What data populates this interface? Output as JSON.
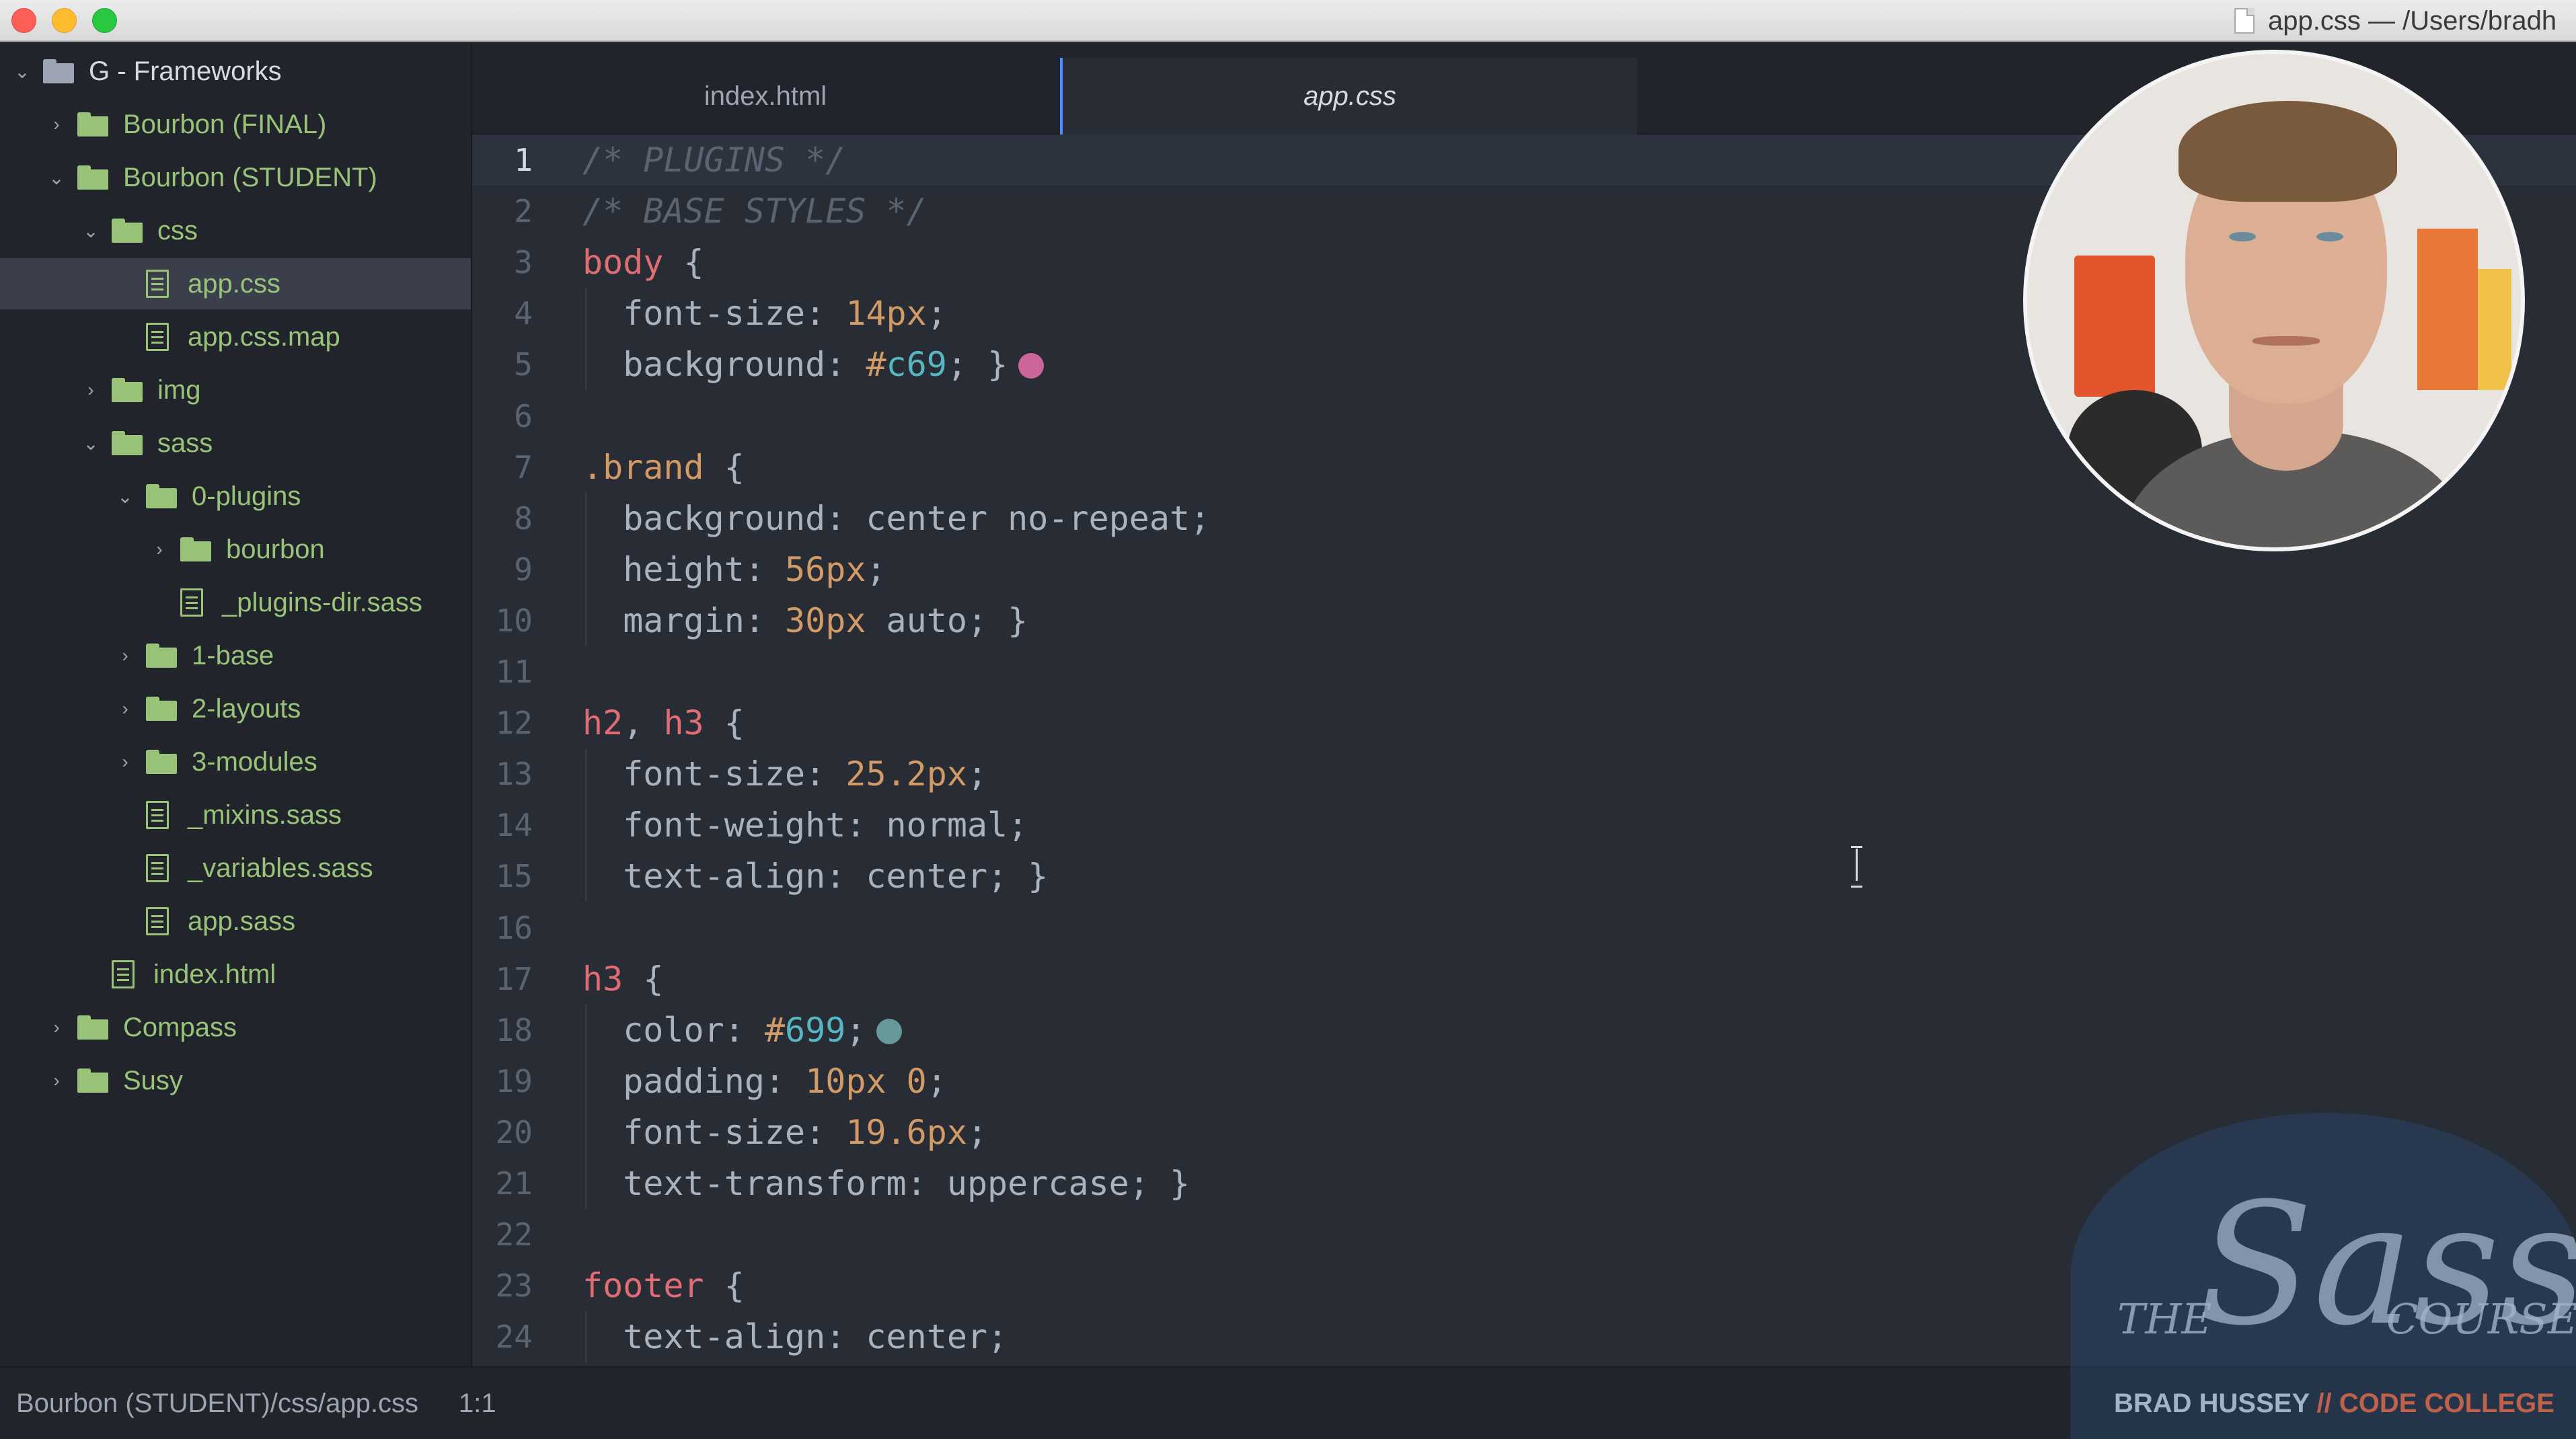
{
  "window": {
    "title": "app.css — /Users/bradh",
    "controls": [
      "close",
      "minimize",
      "zoom"
    ]
  },
  "sidebar": {
    "items": [
      {
        "label": "G - Frameworks",
        "type": "folder",
        "depth": 0,
        "expanded": true,
        "root": true
      },
      {
        "label": "Bourbon (FINAL)",
        "type": "folder",
        "depth": 1,
        "expanded": false
      },
      {
        "label": "Bourbon (STUDENT)",
        "type": "folder",
        "depth": 1,
        "expanded": true
      },
      {
        "label": "css",
        "type": "folder",
        "depth": 2,
        "expanded": true
      },
      {
        "label": "app.css",
        "type": "file",
        "depth": 3,
        "selected": true
      },
      {
        "label": "app.css.map",
        "type": "file",
        "depth": 3
      },
      {
        "label": "img",
        "type": "folder",
        "depth": 2,
        "expanded": false
      },
      {
        "label": "sass",
        "type": "folder",
        "depth": 2,
        "expanded": true
      },
      {
        "label": "0-plugins",
        "type": "folder",
        "depth": 3,
        "expanded": true
      },
      {
        "label": "bourbon",
        "type": "folder",
        "depth": 4,
        "expanded": false
      },
      {
        "label": "_plugins-dir.sass",
        "type": "file",
        "depth": 4
      },
      {
        "label": "1-base",
        "type": "folder",
        "depth": 3,
        "expanded": false
      },
      {
        "label": "2-layouts",
        "type": "folder",
        "depth": 3,
        "expanded": false
      },
      {
        "label": "3-modules",
        "type": "folder",
        "depth": 3,
        "expanded": false
      },
      {
        "label": "_mixins.sass",
        "type": "file",
        "depth": 3
      },
      {
        "label": "_variables.sass",
        "type": "file",
        "depth": 3
      },
      {
        "label": "app.sass",
        "type": "file",
        "depth": 3
      },
      {
        "label": "index.html",
        "type": "file",
        "depth": 2
      },
      {
        "label": "Compass",
        "type": "folder",
        "depth": 1,
        "expanded": false
      },
      {
        "label": "Susy",
        "type": "folder",
        "depth": 1,
        "expanded": false
      }
    ]
  },
  "tabs": [
    {
      "label": "index.html",
      "active": false
    },
    {
      "label": "app.css",
      "active": true
    }
  ],
  "editor": {
    "current_line": 1,
    "lines": [
      {
        "n": "1",
        "tokens": [
          {
            "t": "/* PLUGINS */",
            "c": "comment"
          }
        ]
      },
      {
        "n": "2",
        "tokens": [
          {
            "t": "/* BASE STYLES */",
            "c": "comment"
          }
        ]
      },
      {
        "n": "3",
        "tokens": [
          {
            "t": "body",
            "c": "tag"
          },
          {
            "t": " {",
            "c": "prop"
          }
        ]
      },
      {
        "n": "4",
        "tokens": [
          {
            "t": "  font-size: ",
            "c": "prop"
          },
          {
            "t": "14px",
            "c": "num"
          },
          {
            "t": ";",
            "c": "prop"
          }
        ]
      },
      {
        "n": "5",
        "tokens": [
          {
            "t": "  background: ",
            "c": "prop"
          },
          {
            "t": "#",
            "c": "hash"
          },
          {
            "t": "c69",
            "c": "hex"
          },
          {
            "t": "; }",
            "c": "prop"
          }
        ],
        "swatch": "#cc6699"
      },
      {
        "n": "6",
        "tokens": []
      },
      {
        "n": "7",
        "tokens": [
          {
            "t": ".brand",
            "c": "class"
          },
          {
            "t": " {",
            "c": "prop"
          }
        ]
      },
      {
        "n": "8",
        "tokens": [
          {
            "t": "  background: center no-repeat;",
            "c": "prop"
          }
        ]
      },
      {
        "n": "9",
        "tokens": [
          {
            "t": "  height: ",
            "c": "prop"
          },
          {
            "t": "56px",
            "c": "num"
          },
          {
            "t": ";",
            "c": "prop"
          }
        ]
      },
      {
        "n": "10",
        "tokens": [
          {
            "t": "  margin: ",
            "c": "prop"
          },
          {
            "t": "30px",
            "c": "num"
          },
          {
            "t": " auto; }",
            "c": "prop"
          }
        ]
      },
      {
        "n": "11",
        "tokens": []
      },
      {
        "n": "12",
        "tokens": [
          {
            "t": "h2",
            "c": "tag"
          },
          {
            "t": ", ",
            "c": "prop"
          },
          {
            "t": "h3",
            "c": "tag"
          },
          {
            "t": " {",
            "c": "prop"
          }
        ]
      },
      {
        "n": "13",
        "tokens": [
          {
            "t": "  font-size: ",
            "c": "prop"
          },
          {
            "t": "25.2px",
            "c": "num"
          },
          {
            "t": ";",
            "c": "prop"
          }
        ]
      },
      {
        "n": "14",
        "tokens": [
          {
            "t": "  font-weight: normal;",
            "c": "prop"
          }
        ]
      },
      {
        "n": "15",
        "tokens": [
          {
            "t": "  text-align: center; }",
            "c": "prop"
          }
        ]
      },
      {
        "n": "16",
        "tokens": []
      },
      {
        "n": "17",
        "tokens": [
          {
            "t": "h3",
            "c": "tag"
          },
          {
            "t": " {",
            "c": "prop"
          }
        ]
      },
      {
        "n": "18",
        "tokens": [
          {
            "t": "  color: ",
            "c": "prop"
          },
          {
            "t": "#",
            "c": "hash"
          },
          {
            "t": "699",
            "c": "hex"
          },
          {
            "t": ";",
            "c": "prop"
          }
        ],
        "swatch": "#669999"
      },
      {
        "n": "19",
        "tokens": [
          {
            "t": "  padding: ",
            "c": "prop"
          },
          {
            "t": "10px",
            "c": "num"
          },
          {
            "t": " ",
            "c": "prop"
          },
          {
            "t": "0",
            "c": "num"
          },
          {
            "t": ";",
            "c": "prop"
          }
        ]
      },
      {
        "n": "20",
        "tokens": [
          {
            "t": "  font-size: ",
            "c": "prop"
          },
          {
            "t": "19.6px",
            "c": "num"
          },
          {
            "t": ";",
            "c": "prop"
          }
        ]
      },
      {
        "n": "21",
        "tokens": [
          {
            "t": "  text-transform: uppercase; }",
            "c": "prop"
          }
        ]
      },
      {
        "n": "22",
        "tokens": []
      },
      {
        "n": "23",
        "tokens": [
          {
            "t": "footer",
            "c": "tag"
          },
          {
            "t": " {",
            "c": "prop"
          }
        ]
      },
      {
        "n": "24",
        "tokens": [
          {
            "t": "  text-align: center;",
            "c": "prop"
          }
        ]
      }
    ]
  },
  "statusbar": {
    "path": "Bourbon (STUDENT)/css/app.css",
    "position": "1:1"
  },
  "overlay": {
    "logo_the": "THE",
    "logo_sass": "Sass",
    "logo_course": "COURSE",
    "logo_author": "BRAD HUSSEY",
    "logo_sep": " // ",
    "logo_org": "CODE COLLEGE"
  },
  "colors": {
    "accent": "#528bff",
    "tree_green": "#98c379",
    "tag": "#e06c75",
    "number": "#d19a66",
    "hex": "#56b6c2",
    "comment": "#5c6370"
  },
  "icons": {
    "folder": "folder-icon",
    "file": "file-text-icon",
    "expanded": "chevron-down-icon",
    "collapsed": "chevron-right-icon"
  }
}
